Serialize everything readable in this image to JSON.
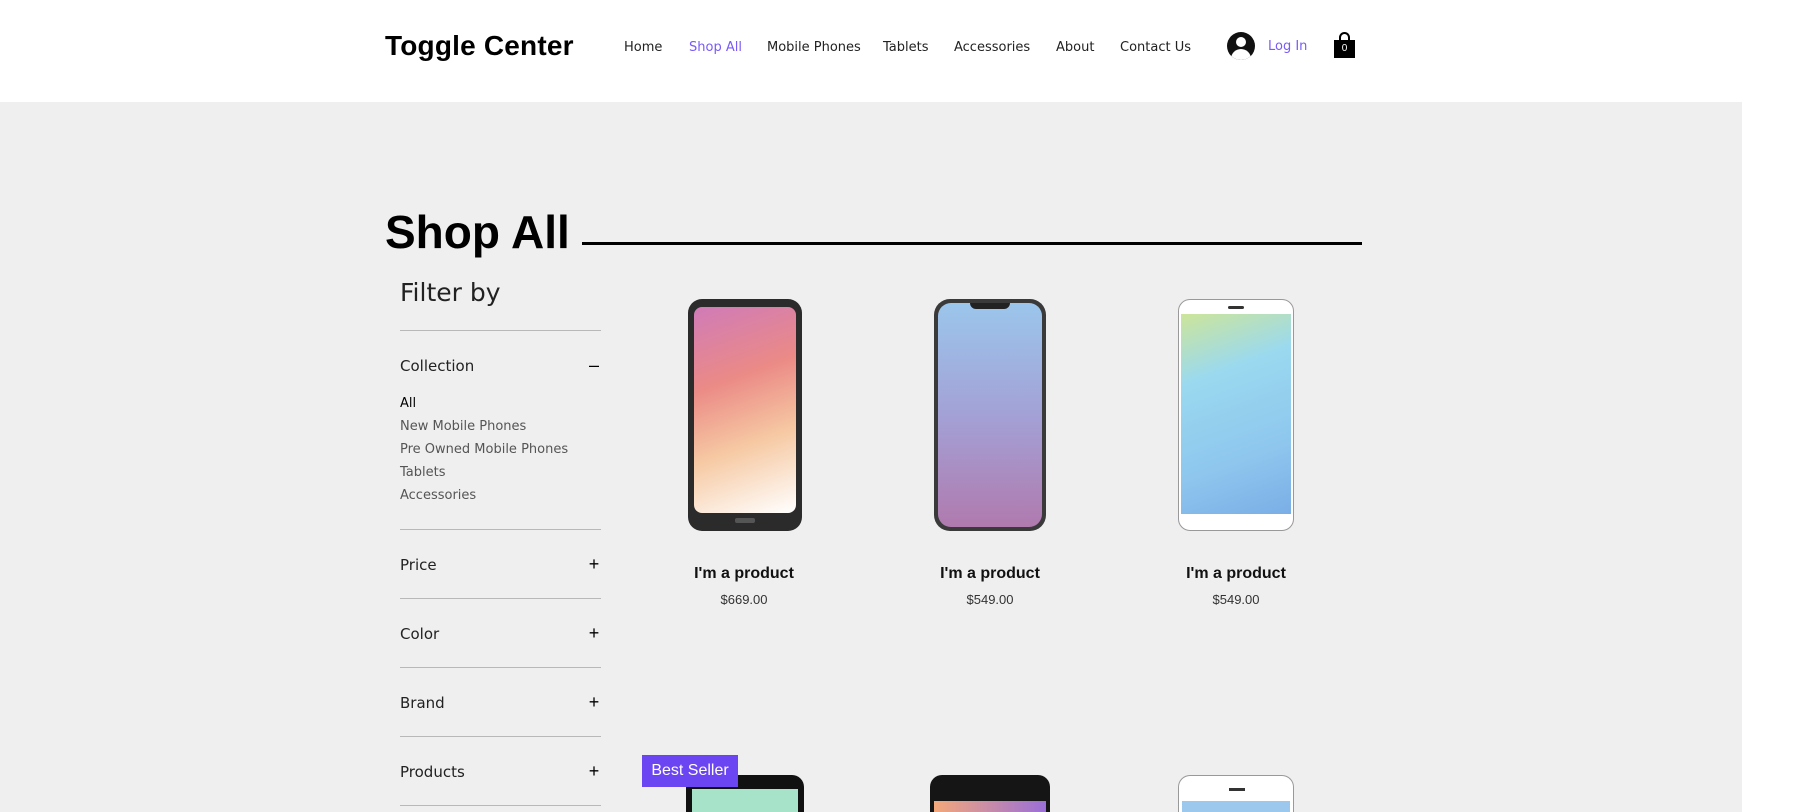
{
  "header": {
    "site_title": "Toggle Center",
    "nav": [
      {
        "label": "Home",
        "active": false
      },
      {
        "label": "Shop All",
        "active": true
      },
      {
        "label": "Mobile Phones",
        "active": false
      },
      {
        "label": "Tablets",
        "active": false
      },
      {
        "label": "Accessories",
        "active": false
      },
      {
        "label": "About",
        "active": false
      },
      {
        "label": "Contact Us",
        "active": false
      }
    ],
    "login_label": "Log In",
    "cart_count": "0",
    "accent_color": "#7a5af8"
  },
  "main": {
    "page_title": "Shop All",
    "filter_title": "Filter by",
    "filters": [
      {
        "label": "Collection",
        "toggle": "–",
        "expanded": true
      },
      {
        "label": "Price",
        "toggle": "+",
        "expanded": false
      },
      {
        "label": "Color",
        "toggle": "+",
        "expanded": false
      },
      {
        "label": "Brand",
        "toggle": "+",
        "expanded": false
      },
      {
        "label": "Products",
        "toggle": "+",
        "expanded": false
      }
    ],
    "collections": [
      {
        "label": "All",
        "active": true
      },
      {
        "label": "New Mobile Phones",
        "active": false
      },
      {
        "label": "Pre Owned Mobile Phones",
        "active": false
      },
      {
        "label": "Tablets",
        "active": false
      },
      {
        "label": "Accessories",
        "active": false
      }
    ],
    "products": [
      {
        "name": "I'm a product",
        "price": "$669.00",
        "image": "phone-sunset-gradient"
      },
      {
        "name": "I'm a product",
        "price": "$549.00",
        "image": "phone-purple-gradient"
      },
      {
        "name": "I'm a product",
        "price": "$549.00",
        "image": "phone-blue-gradient"
      }
    ],
    "badge_label": "Best Seller",
    "badge_color": "#6b45f2"
  }
}
